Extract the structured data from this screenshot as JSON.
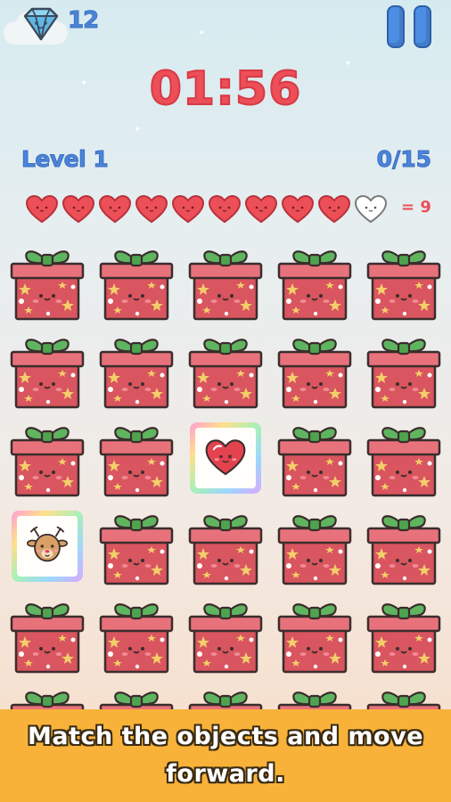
{
  "hud": {
    "gems": "12",
    "timer": "01:56",
    "level": "Level 1",
    "progress": "0/15",
    "lives_label": "= 9"
  },
  "hearts": {
    "total": 10,
    "filled": 9
  },
  "grid": {
    "columns": 5,
    "cells": [
      "gift",
      "gift",
      "gift",
      "gift",
      "gift",
      "gift",
      "gift",
      "gift",
      "gift",
      "gift",
      "gift",
      "gift",
      "heart-card",
      "gift",
      "gift",
      "deer-card",
      "gift",
      "gift",
      "gift",
      "gift",
      "gift",
      "gift",
      "gift",
      "gift",
      "gift",
      "gift",
      "gift",
      "gift",
      "gift",
      "gift"
    ]
  },
  "banner": {
    "line1": "Match the objects and move",
    "line2": "forward."
  },
  "colors": {
    "accent_blue": "#4b84d9",
    "timer_red": "#ec4f57",
    "gift_body": "#d9555f",
    "bow_green": "#5fb55f",
    "banner_orange": "#f8b23a"
  },
  "icons": {
    "gem": "diamond-icon",
    "pause": "pause-icon",
    "heart": "heart-icon"
  }
}
